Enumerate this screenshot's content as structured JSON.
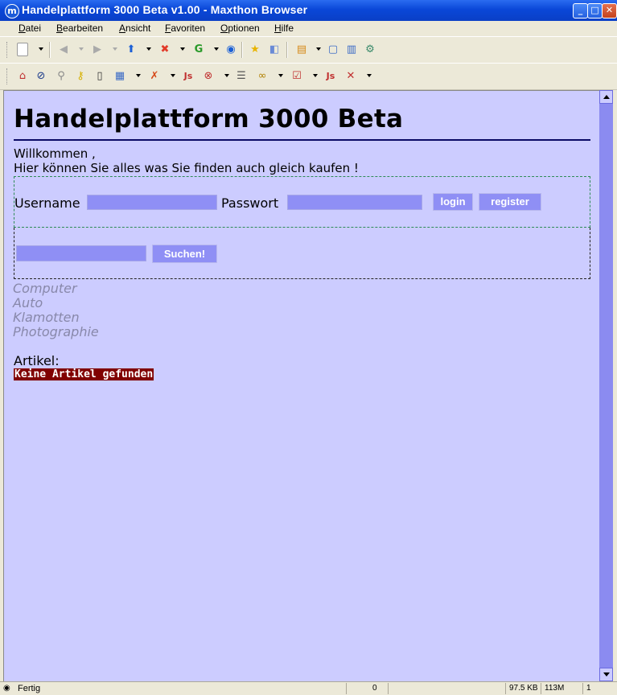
{
  "window": {
    "title": "Handelplattform 3000 Beta v1.00 - Maxthon Browser",
    "app_icon": "m"
  },
  "menu": [
    "Datei",
    "Bearbeiten",
    "Ansicht",
    "Favoriten",
    "Optionen",
    "Hilfe"
  ],
  "toolbar_icons": {
    "row1": [
      "new-page-icon",
      "back-icon",
      "forward-icon",
      "home-icon",
      "stop-icon",
      "refresh-icon",
      "homepage-icon",
      "favorites-icon",
      "clipboard-icon",
      "tab-list-icon",
      "fullscreen-icon",
      "split-view-icon",
      "tools-icon"
    ],
    "row2": [
      "plugin-icon",
      "compass-icon",
      "link-icon",
      "key-icon",
      "notes-icon",
      "calendar-icon",
      "no-image-icon",
      "javascript-icon",
      "popup-block-icon",
      "list-icon",
      "glasses-icon",
      "checkbox-icon",
      "javascript-toggle-icon",
      "close-filter-icon"
    ]
  },
  "page": {
    "title": "Handelplattform 3000 Beta",
    "welcome_line1": "Willkommen ,",
    "welcome_line2": "Hier können Sie alles was Sie finden auch gleich kaufen !",
    "username_label": "Username",
    "username_value": "",
    "password_label": "Passwort",
    "password_value": "",
    "login_button": "login",
    "register_button": "register",
    "search_value": "",
    "search_button": "Suchen!",
    "categories": [
      "Computer",
      "Auto",
      "Klamotten",
      "Photographie"
    ],
    "articles_label": "Artikel:",
    "no_articles": "Keine Artikel gefunden"
  },
  "colors": {
    "page_background": "#ccccff",
    "field_background": "#8f8ff5",
    "notice_background": "#800000",
    "category_text": "#8888aa",
    "scrollbar": "#8b8bf0"
  },
  "status": {
    "text": "Fertig",
    "popup_count": "0",
    "page_size": "97.5 KB",
    "memory": "113M",
    "tabs": "1"
  }
}
